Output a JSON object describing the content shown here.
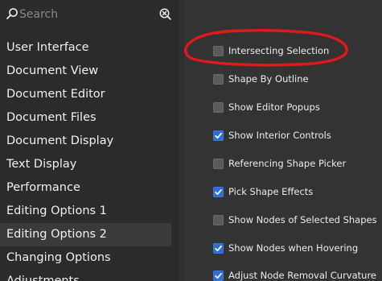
{
  "search": {
    "placeholder": "Search",
    "value": ""
  },
  "sidebar": {
    "items": [
      {
        "label": "User Interface",
        "selected": false
      },
      {
        "label": "Document View",
        "selected": false
      },
      {
        "label": "Document Editor",
        "selected": false
      },
      {
        "label": "Document Files",
        "selected": false
      },
      {
        "label": "Document Display",
        "selected": false
      },
      {
        "label": "Text Display",
        "selected": false
      },
      {
        "label": "Performance",
        "selected": false
      },
      {
        "label": "Editing Options 1",
        "selected": false
      },
      {
        "label": "Editing Options 2",
        "selected": true
      },
      {
        "label": "Changing Options",
        "selected": false
      },
      {
        "label": "Adjustments",
        "selected": false
      }
    ]
  },
  "options": [
    {
      "label": "Intersecting Selection",
      "checked": false
    },
    {
      "label": "Shape By Outline",
      "checked": false
    },
    {
      "label": "Show Editor Popups",
      "checked": false
    },
    {
      "label": "Show Interior Controls",
      "checked": true
    },
    {
      "label": "Referencing Shape Picker",
      "checked": false
    },
    {
      "label": "Pick Shape Effects",
      "checked": true
    },
    {
      "label": "Show Nodes of Selected Shapes",
      "checked": false
    },
    {
      "label": "Show Nodes when Hovering",
      "checked": true
    },
    {
      "label": "Adjust Node Removal Curvature",
      "checked": true
    }
  ],
  "colors": {
    "sidebar_bg": "#2b2b2b",
    "content_bg": "#333333",
    "checkbox_checked": "#2f6ecf",
    "annotation_red": "#e0191b"
  }
}
